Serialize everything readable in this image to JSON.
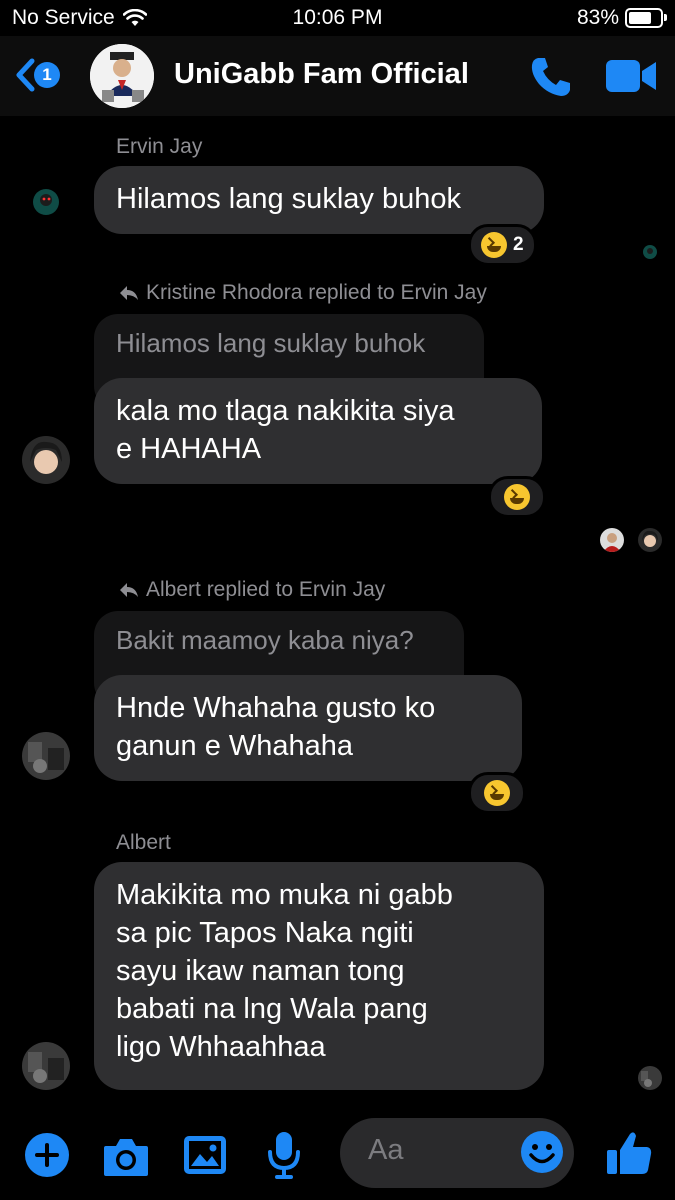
{
  "status_bar": {
    "carrier": "No Service",
    "time": "10:06 PM",
    "battery": "83%",
    "battery_level": 0.83
  },
  "header": {
    "back_badge": "1",
    "title": "UniGabb Fam Official"
  },
  "messages": [
    {
      "sender": "Ervin Jay",
      "text": "Hilamos lang suklay buhok",
      "reaction_count": "2"
    },
    {
      "reply_label": "Kristine Rhodora replied to Ervin Jay",
      "quoted": "Hilamos lang suklay buhok",
      "lines": [
        "kala mo tlaga nakikita siya",
        "e HAHAHA"
      ]
    },
    {
      "reply_label": "Albert replied to Ervin Jay",
      "quoted": "Bakit maamoy kaba niya?",
      "lines": [
        "Hnde Whahaha gusto ko",
        "ganun e Whahaha"
      ]
    },
    {
      "sender": "Albert",
      "lines": [
        "Makikita mo muka ni gabb",
        "sa pic Tapos Naka ngiti",
        "sayu ikaw naman tong",
        "babati na lng Wala pang",
        "ligo Whhaahhaa"
      ]
    }
  ],
  "composer": {
    "placeholder": "Aa"
  },
  "colors": {
    "accent": "#1e88f5",
    "bubble": "#2f2f31",
    "background": "#000000"
  }
}
